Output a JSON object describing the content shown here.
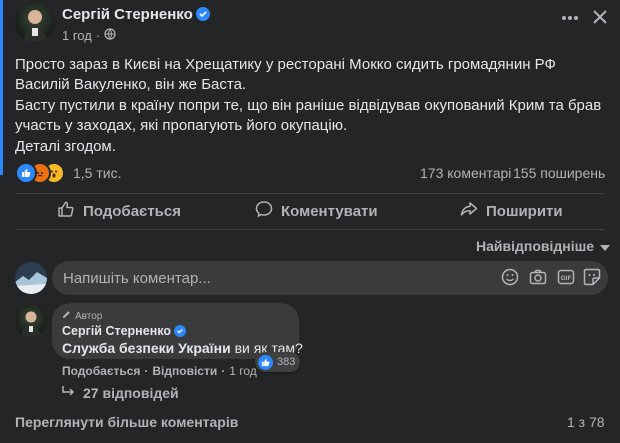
{
  "post": {
    "author": "Сергій Стерненко",
    "time": "1 год",
    "paragraphs": [
      "Просто зараз в Києві на Хрещатику у ресторані Мокко сидить громадянин РФ Василій Вакуленко, він же Баста.",
      "Басту пустили в країну попри те, що він раніше відвідував окупований Крим та брав участь у заходах, які пропагують його окупацію.",
      "Деталі згодом."
    ],
    "reactions_count": "1,5 тис.",
    "comments_count": "173 коментарі",
    "shares_count": "155 поширень"
  },
  "actions": {
    "like": "Подобається",
    "comment": "Коментувати",
    "share": "Поширити"
  },
  "sort_label": "Найвідповідніше",
  "comment_box": {
    "placeholder": "Напишіть коментар..."
  },
  "top_comment": {
    "badge": "Автор",
    "author": "Сергій Стерненко",
    "text_bold": "Служба безпеки України",
    "text_rest": " ви як там?",
    "reactions": "383",
    "like": "Подобається",
    "reply": "Відповісти",
    "time": "1 год",
    "replies_label": "27 відповідей"
  },
  "footer": {
    "more_comments": "Переглянути більше коментарів",
    "pagination": "1 з 78"
  },
  "colors": {
    "background": "#242526",
    "accent": "#2d88ff",
    "text": "#e4e6eb",
    "muted": "#b0b3b8"
  }
}
